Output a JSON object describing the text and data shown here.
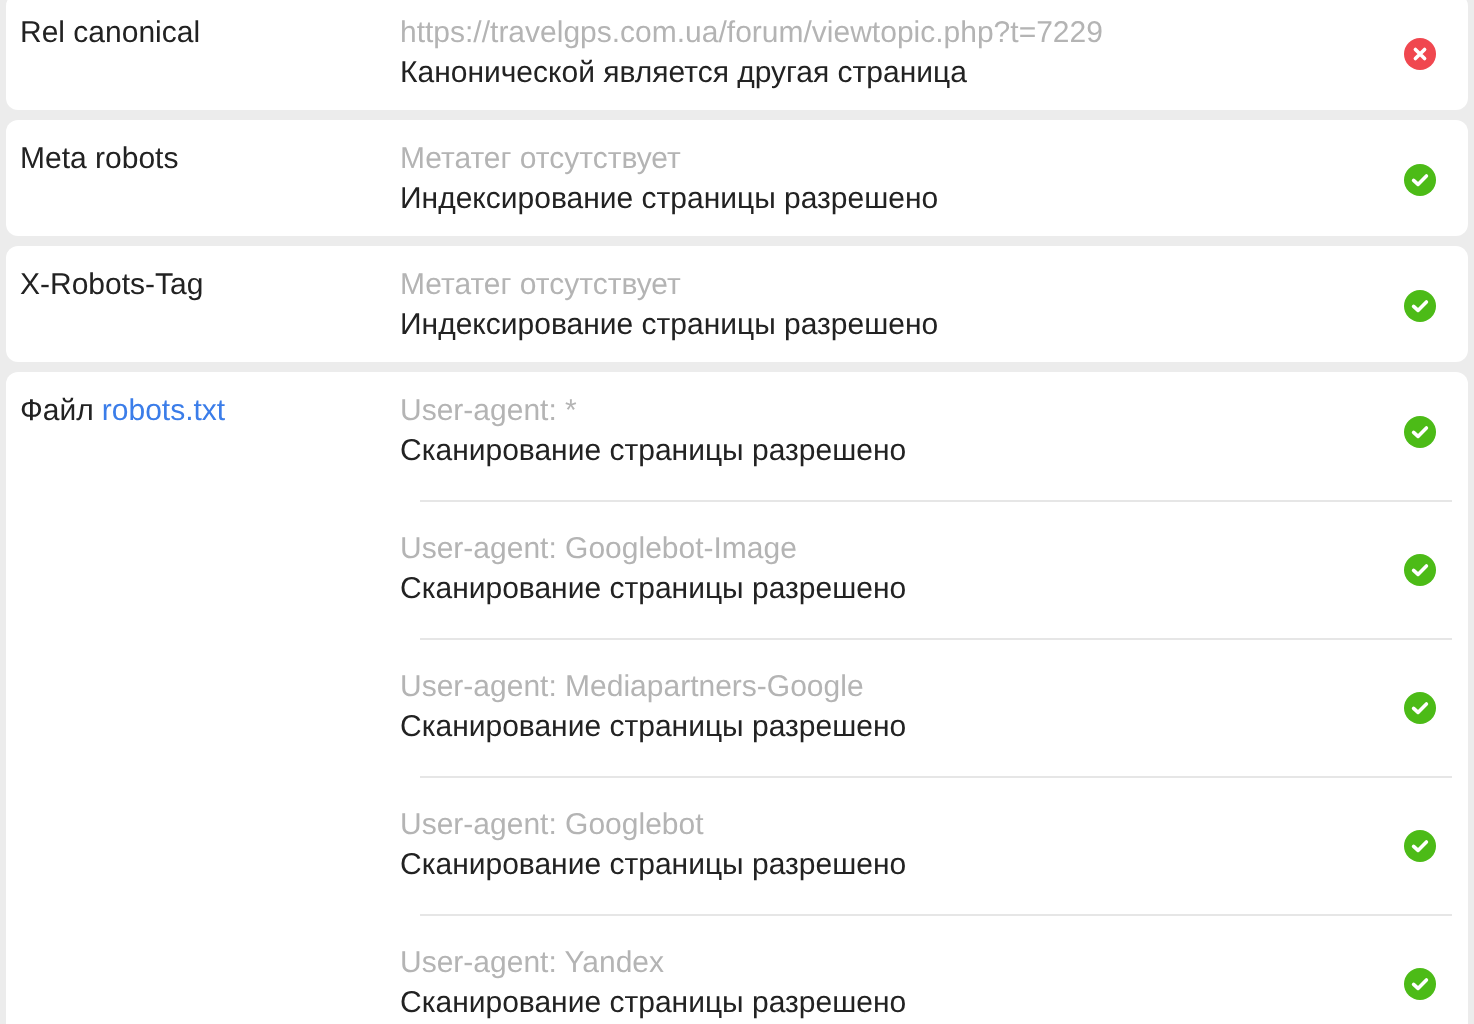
{
  "checks": [
    {
      "label": "Rel canonical",
      "entries": [
        {
          "hint": "https://travelgps.com.ua/forum/viewtopic.php?t=7229",
          "status_text": "Канонической является другая страница",
          "passed": false
        }
      ]
    },
    {
      "label": "Meta robots",
      "entries": [
        {
          "hint": "Метатег отсутствует",
          "status_text": "Индексирование страницы разрешено",
          "passed": true
        }
      ]
    },
    {
      "label": "X-Robots-Tag",
      "entries": [
        {
          "hint": "Метатег отсутствует",
          "status_text": "Индексирование страницы разрешено",
          "passed": true
        }
      ]
    },
    {
      "label": "Файл",
      "link": "robots.txt",
      "entries": [
        {
          "hint": "User-agent: *",
          "status_text": "Сканирование страницы разрешено",
          "passed": true
        },
        {
          "hint": "User-agent: Googlebot-Image",
          "status_text": "Сканирование страницы разрешено",
          "passed": true
        },
        {
          "hint": "User-agent: Mediapartners-Google",
          "status_text": "Сканирование страницы разрешено",
          "passed": true
        },
        {
          "hint": "User-agent: Googlebot",
          "status_text": "Сканирование страницы разрешено",
          "passed": true
        },
        {
          "hint": "User-agent: Yandex",
          "status_text": "Сканирование страницы разрешено",
          "passed": true
        }
      ]
    }
  ]
}
